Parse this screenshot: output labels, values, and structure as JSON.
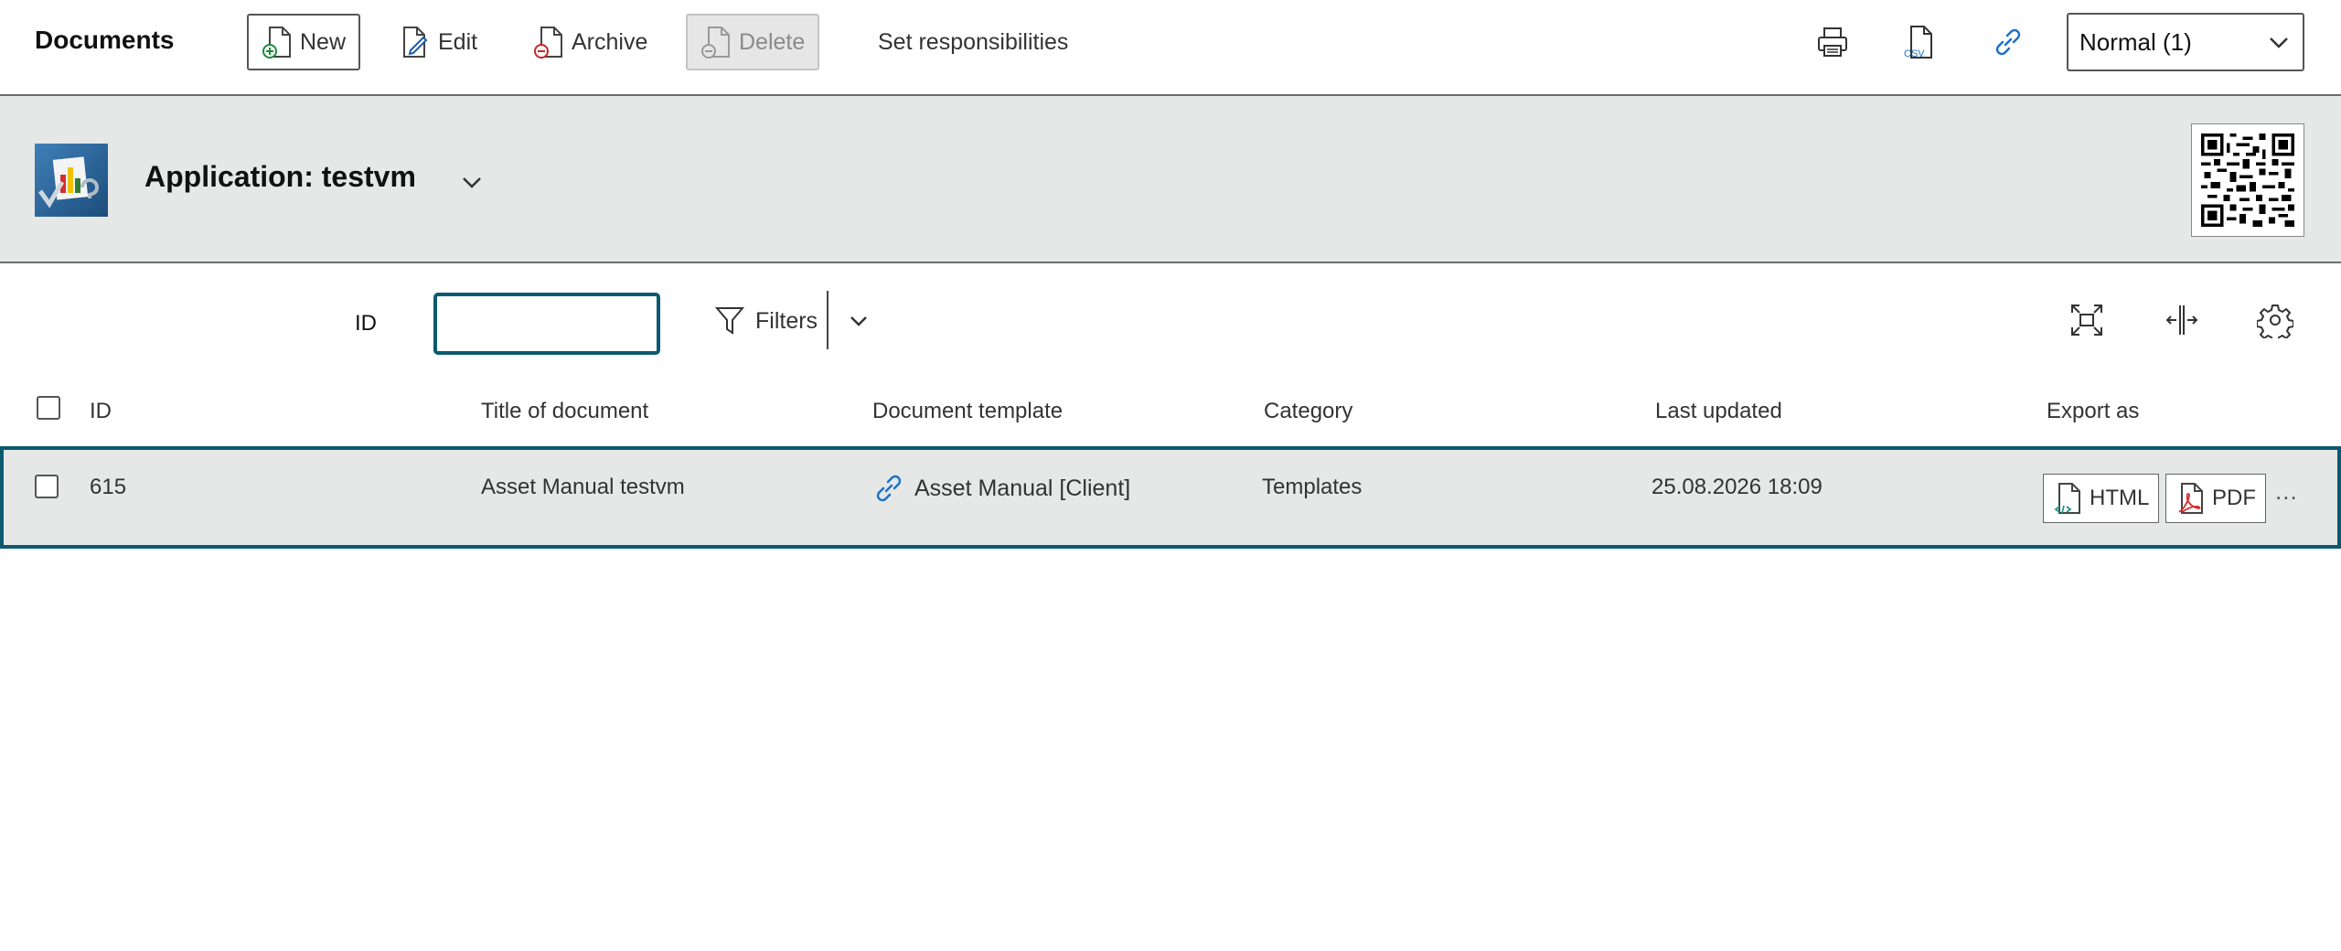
{
  "toolbar": {
    "title": "Documents",
    "new_label": "New",
    "edit_label": "Edit",
    "archive_label": "Archive",
    "delete_label": "Delete",
    "responsibilities_label": "Set responsibilities",
    "view_select": "Normal (1)",
    "csv_icon_text": "CSV"
  },
  "header": {
    "title": "Application: testvm"
  },
  "filter": {
    "id_label": "ID",
    "id_value": "",
    "filters_label": "Filters"
  },
  "table": {
    "columns": [
      "ID",
      "Title of document",
      "Document template",
      "Category",
      "Last updated",
      "Export as"
    ],
    "rows": [
      {
        "id": "615",
        "title": "Asset Manual testvm",
        "template": "Asset Manual [Client]",
        "category": "Templates",
        "last_updated": "25.08.2026 18:09",
        "export_html": "HTML",
        "export_pdf": "PDF",
        "more": "..."
      }
    ]
  },
  "colors": {
    "accent": "#0b5a70",
    "band_bg": "#e6e7e7",
    "link_blue": "#1a73c8"
  }
}
